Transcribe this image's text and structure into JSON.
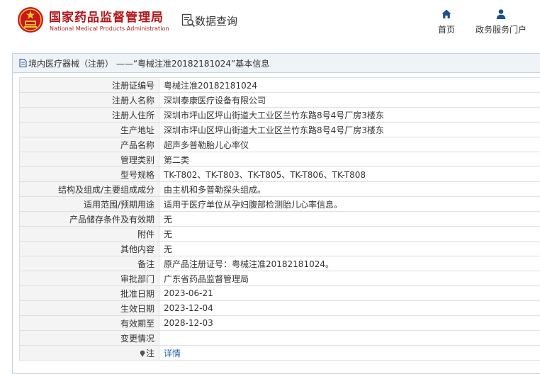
{
  "header": {
    "title_cn": "国家药品监督管理局",
    "title_en": "National Medical Products Administration",
    "query_label": "数据查询",
    "nav": [
      {
        "label": "首页",
        "icon": "home-icon"
      },
      {
        "label": "政务服务门户",
        "icon": "user-icon"
      }
    ]
  },
  "panel": {
    "title": "境内医疗器械（注册） ——“粤械注准20182181024”基本信息"
  },
  "rows": [
    {
      "label": "注册证编号",
      "value": "粤械注准20182181024"
    },
    {
      "label": "注册人名称",
      "value": "深圳泰康医疗设备有限公司"
    },
    {
      "label": "注册人住所",
      "value": "深圳市坪山区坪山街道大工业区兰竹东路8号4号厂房3楼东"
    },
    {
      "label": "生产地址",
      "value": "深圳市坪山区坪山街道大工业区兰竹东路8号4号厂房3楼东"
    },
    {
      "label": "产品名称",
      "value": "超声多普勒胎儿心率仪"
    },
    {
      "label": "管理类别",
      "value": "第二类"
    },
    {
      "label": "型号规格",
      "value": "TK-T802、TK-T803、TK-T805、TK-T806、TK-T808"
    },
    {
      "label": "结构及组成/主要组成成分",
      "value": "由主机和多普勒探头组成。"
    },
    {
      "label": "适用范围/预期用途",
      "value": "适用于医疗单位从孕妇腹部检测胎儿心率信息。"
    },
    {
      "label": "产品储存条件及有效期",
      "value": "无"
    },
    {
      "label": "附件",
      "value": "无"
    },
    {
      "label": "其他内容",
      "value": "无"
    },
    {
      "label": "备注",
      "value": "原产品注册证号：粤械注准20182181024。"
    },
    {
      "label": "审批部门",
      "value": "广东省药品监督管理局"
    },
    {
      "label": "批准日期",
      "value": "2023-06-21"
    },
    {
      "label": "生效日期",
      "value": "2023-12-04"
    },
    {
      "label": "有效期至",
      "value": "2028-12-03"
    },
    {
      "label": "变更情况",
      "value": ""
    }
  ],
  "note_row": {
    "label": "注",
    "link": "详情"
  },
  "colors": {
    "brand_red": "#b3171a",
    "link_blue": "#1a63b5",
    "label_bg": "#f4f4f4",
    "title_bg": "#eef3f8"
  }
}
